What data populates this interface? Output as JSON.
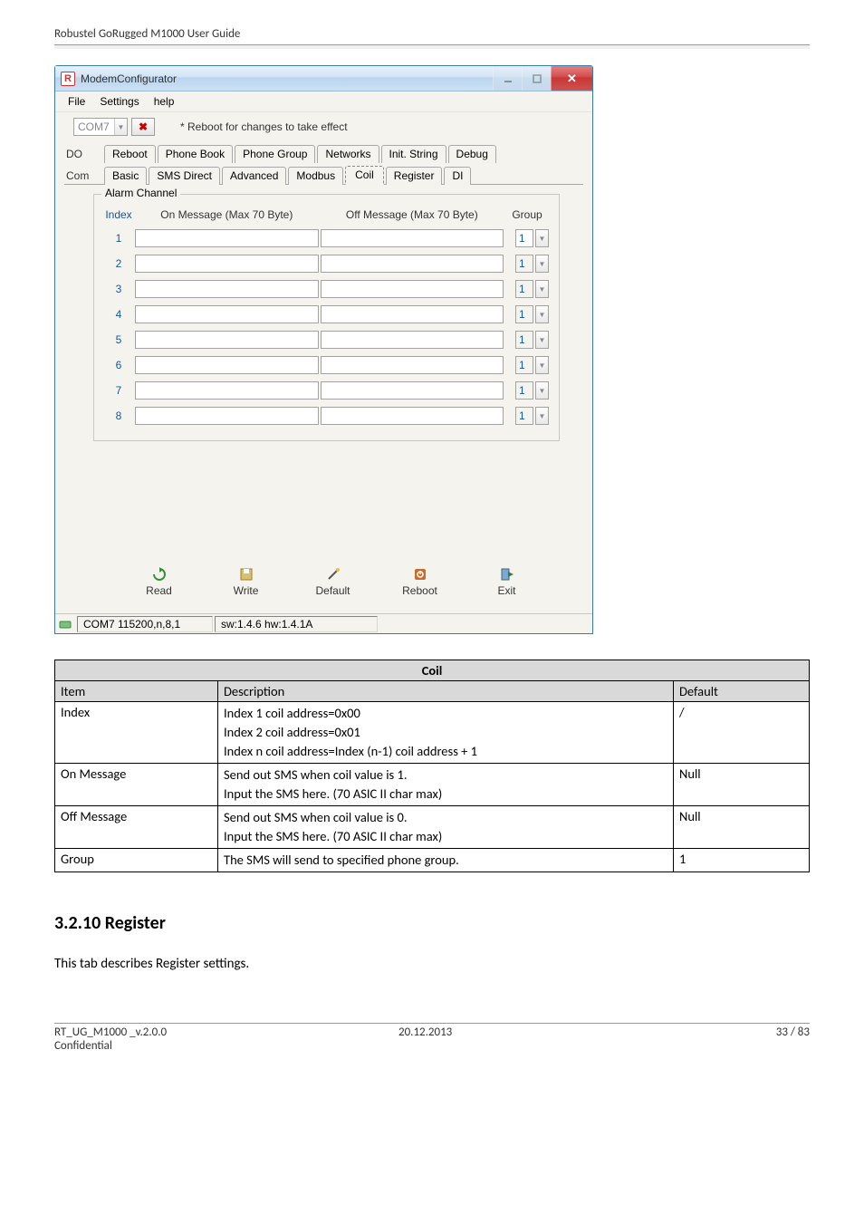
{
  "doc_header": "Robustel GoRugged M1000 User Guide",
  "window": {
    "title": "ModemConfigurator",
    "app_icon_letter": "R",
    "menu": {
      "file": "File",
      "settings": "Settings",
      "help": "help"
    },
    "toolbar": {
      "com_port": "COM7",
      "disconnect_glyph": "✖",
      "reboot_note": "* Reboot for changes to take effect"
    },
    "tabs_row1": {
      "left_label": "DO",
      "items": [
        "Reboot",
        "Phone Book",
        "Phone Group",
        "Networks",
        "Init. String",
        "Debug"
      ]
    },
    "tabs_row2": {
      "left_label": "Com",
      "items": [
        "Basic",
        "SMS Direct",
        "Advanced",
        "Modbus",
        "Coil",
        "Register",
        "DI"
      ],
      "active_index": 4
    },
    "groupbox": {
      "legend": "Alarm Channel",
      "headers": {
        "index": "Index",
        "on": "On Message (Max 70 Byte)",
        "off": "Off Message (Max 70 Byte)",
        "group": "Group"
      },
      "rows": [
        {
          "index": "1",
          "on": "",
          "off": "",
          "group": "1"
        },
        {
          "index": "2",
          "on": "",
          "off": "",
          "group": "1"
        },
        {
          "index": "3",
          "on": "",
          "off": "",
          "group": "1"
        },
        {
          "index": "4",
          "on": "",
          "off": "",
          "group": "1"
        },
        {
          "index": "5",
          "on": "",
          "off": "",
          "group": "1"
        },
        {
          "index": "6",
          "on": "",
          "off": "",
          "group": "1"
        },
        {
          "index": "7",
          "on": "",
          "off": "",
          "group": "1"
        },
        {
          "index": "8",
          "on": "",
          "off": "",
          "group": "1"
        }
      ]
    },
    "buttons": {
      "read": "Read",
      "write": "Write",
      "default": "Default",
      "reboot": "Reboot",
      "exit": "Exit"
    },
    "statusbar": {
      "port": "COM7 115200,n,8,1",
      "version": "sw:1.4.6 hw:1.4.1A"
    }
  },
  "spec_table": {
    "title": "Coil",
    "header": {
      "item": "Item",
      "desc": "Description",
      "def": "Default"
    },
    "rows": [
      {
        "item": "Index",
        "desc_lines": [
          "Index 1 coil address=0x00",
          "Index 2 coil address=0x01",
          "Index n coil address=Index (n-1) coil address + 1"
        ],
        "def": "/"
      },
      {
        "item": "On Message",
        "desc_lines": [
          "Send out SMS when coil value is 1.",
          "Input the SMS here. (70 ASIC II char max)"
        ],
        "def": "Null"
      },
      {
        "item": "Off Message",
        "desc_lines": [
          "Send out SMS when coil value is 0.",
          "Input the SMS here. (70 ASIC II char max)"
        ],
        "def": "Null"
      },
      {
        "item": "Group",
        "desc_lines": [
          "The SMS will send to specified phone group."
        ],
        "def": "1"
      }
    ]
  },
  "section": {
    "heading": "3.2.10  Register",
    "body": "This tab describes Register settings."
  },
  "footer": {
    "left1": "RT_UG_M1000 _v.2.0.0",
    "left2": "Confidential",
    "center": "20.12.2013",
    "right": "33 / 83"
  }
}
